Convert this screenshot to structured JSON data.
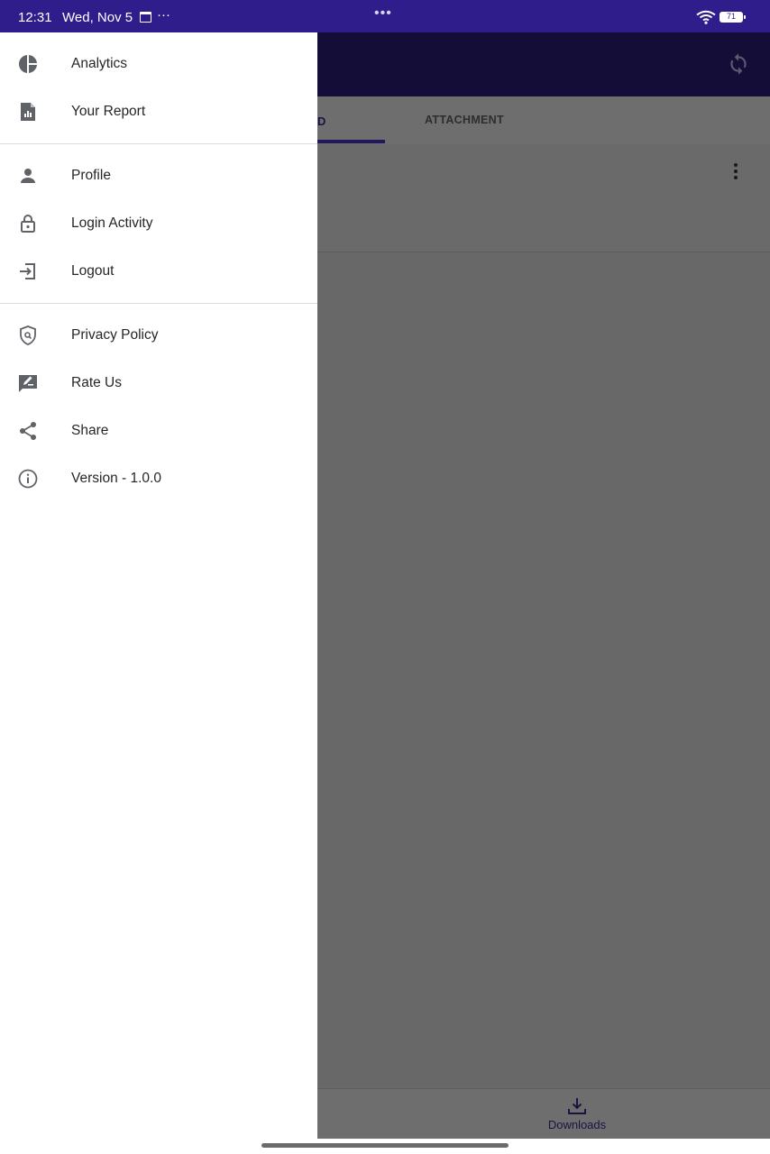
{
  "status_bar": {
    "time": "12:31",
    "date": "Wed, Nov 5",
    "more": "···",
    "battery": "71"
  },
  "background_app": {
    "partial_tab_label": "D",
    "tab_attachment": "ATTACHMENT",
    "bottom_nav_downloads": "Downloads"
  },
  "drawer": {
    "section1": [
      {
        "label": "Analytics",
        "icon": "pie-chart-icon"
      },
      {
        "label": "Your Report",
        "icon": "report-icon"
      }
    ],
    "section2": [
      {
        "label": "Profile",
        "icon": "person-icon"
      },
      {
        "label": "Login Activity",
        "icon": "lock-icon"
      },
      {
        "label": "Logout",
        "icon": "logout-icon"
      }
    ],
    "section3": [
      {
        "label": "Privacy Policy",
        "icon": "shield-icon"
      },
      {
        "label": "Rate Us",
        "icon": "rate-review-icon"
      },
      {
        "label": "Share",
        "icon": "share-icon"
      },
      {
        "label": "Version - 1.0.0",
        "icon": "info-icon"
      }
    ]
  },
  "colors": {
    "status_bar": "#2f1d8c",
    "app_header": "#130d38",
    "scrim_content": "#686868",
    "drawer_icon": "#5f6368",
    "drawer_text": "#262626"
  }
}
